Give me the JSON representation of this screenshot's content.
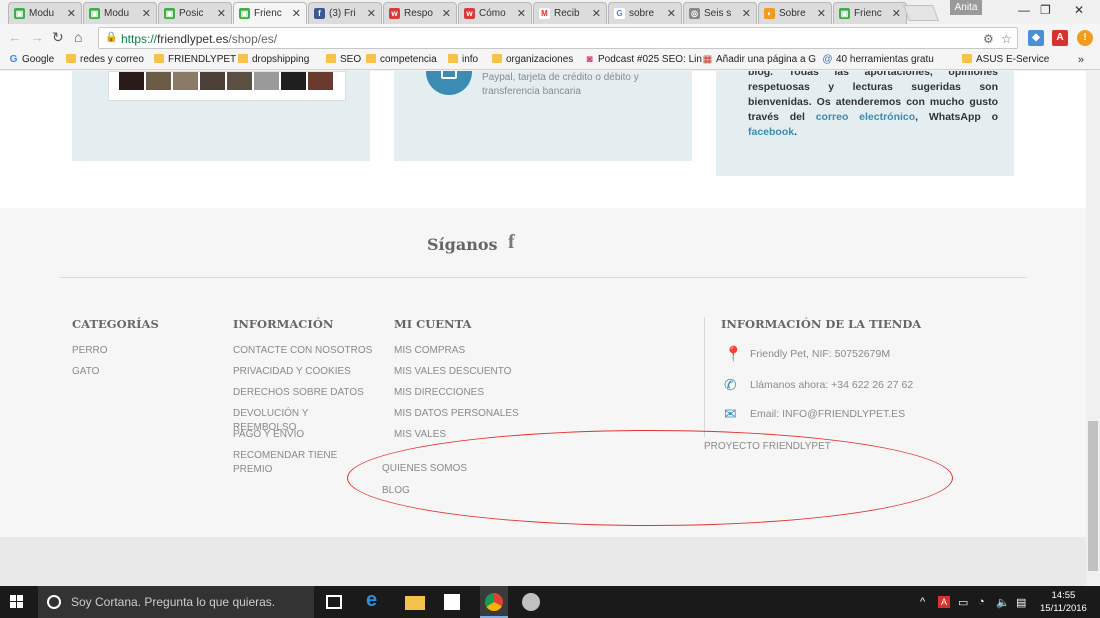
{
  "browser": {
    "tabs": [
      {
        "label": "Modu",
        "fav": "green"
      },
      {
        "label": "Modu",
        "fav": "green"
      },
      {
        "label": "Posic",
        "fav": "green"
      },
      {
        "label": "Frienc",
        "fav": "green",
        "active": true
      },
      {
        "label": "(3) Fri",
        "fav": "facebook"
      },
      {
        "label": "Respo",
        "fav": "red-w"
      },
      {
        "label": "Cómo",
        "fav": "red-w"
      },
      {
        "label": "Recib",
        "fav": "gmail"
      },
      {
        "label": "sobre",
        "fav": "google"
      },
      {
        "label": "Seis s",
        "fav": "gray"
      },
      {
        "label": "Sobre",
        "fav": "orange"
      },
      {
        "label": "Frienc",
        "fav": "green"
      }
    ],
    "profile_name": "Anita",
    "address": {
      "scheme": "https://",
      "host": "friendlypet.es",
      "path": "/shop/es/"
    },
    "bookmarks": [
      {
        "label": "Google",
        "type": "google"
      },
      {
        "label": "redes y correo",
        "type": "folder"
      },
      {
        "label": "FRIENDLYPET",
        "type": "folder"
      },
      {
        "label": "dropshipping",
        "type": "folder"
      },
      {
        "label": "SEO",
        "type": "folder"
      },
      {
        "label": "competencia",
        "type": "folder"
      },
      {
        "label": "info",
        "type": "folder"
      },
      {
        "label": "organizaciones",
        "type": "folder"
      },
      {
        "label": "Podcast #025 SEO: Lin",
        "type": "podcast"
      },
      {
        "label": "Añadir una página a G",
        "type": "page"
      },
      {
        "label": "40 herramientas gratu",
        "type": "at"
      },
      {
        "label": "ASUS E-Service",
        "type": "folder"
      }
    ],
    "bookmarks_more": "»"
  },
  "payment": {
    "text": "Paypal, tarjeta de crédito o débito y transferencia bancaria"
  },
  "blog_card": {
    "line1": "blog. Todas las aportaciones, opiniones respetuosas y lecturas sugeridas son bienvenidas. Os atenderemos con mucho gusto través del ",
    "link1": "correo electrónico",
    "mid": ", WhatsApp o ",
    "link2": "facebook",
    "end": "."
  },
  "social": {
    "title": "Síganos",
    "fb_glyph": "f"
  },
  "footer": {
    "categorias": {
      "title": "CATEGORÍAS",
      "links": [
        "PERRO",
        "GATO"
      ]
    },
    "informacion": {
      "title": "INFORMACIÓN",
      "links": [
        "CONTACTE CON NOSOTROS",
        "PRIVACIDAD Y COOKIES",
        "DERECHOS SOBRE DATOS",
        "DEVOLUCIÓN Y REEMBOLSO",
        "PAGO Y ENVÍO",
        "RECOMENDAR TIENE PREMIO"
      ]
    },
    "cuenta": {
      "title": "MI CUENTA",
      "links": [
        "MIS COMPRAS",
        "MIS VALES DESCUENTO",
        "MIS DIRECCIONES",
        "MIS DATOS PERSONALES",
        "MIS VALES"
      ]
    },
    "extra_links": [
      "QUIENES SOMOS",
      "BLOG"
    ],
    "tienda": {
      "title": "INFORMACIÓN DE LA TIENDA",
      "address": "Friendly Pet, NIF: 50752679M",
      "phone": "Llámanos ahora: +34 622 26 27 62",
      "email": "Email: INFO@FRIENDLYPET.ES"
    },
    "proyecto": "PROYECTO FRIENDLYPET"
  },
  "taskbar": {
    "cortana_text": "Soy Cortana. Pregunta lo que quieras.",
    "time": "14:55",
    "date": "15/11/2016"
  },
  "colors": {
    "accent": "#3c8bb3",
    "annotation": "#e3312f",
    "card_bg": "#e4eef0"
  }
}
